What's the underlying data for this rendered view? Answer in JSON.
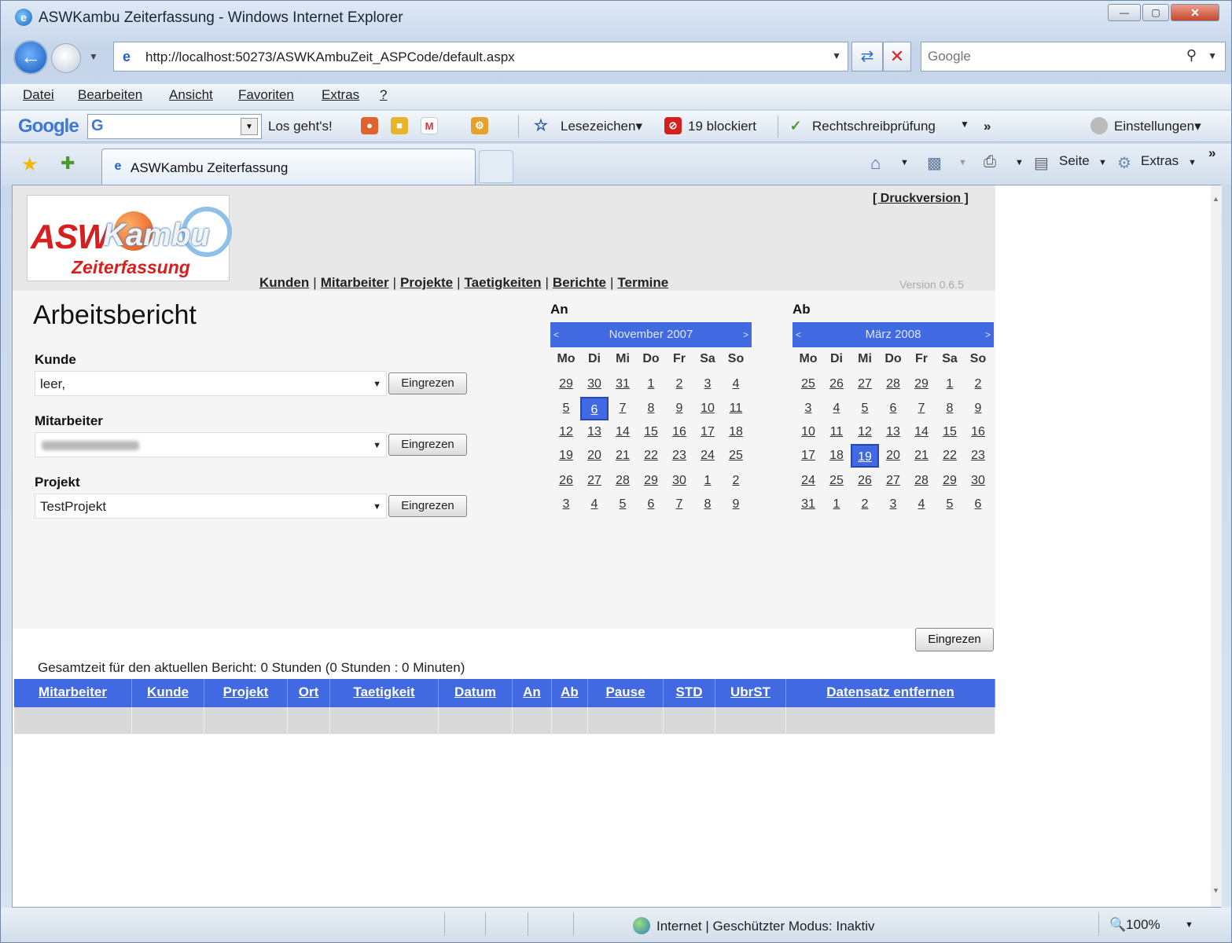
{
  "window": {
    "title": "ASWKambu Zeiterfassung - Windows Internet Explorer"
  },
  "address": {
    "url": "http://localhost:50273/ASWKAmbuZeit_ASPCode/default.aspx"
  },
  "search": {
    "placeholder": "Google"
  },
  "menu": [
    "Datei",
    "Bearbeiten",
    "Ansicht",
    "Favoriten",
    "Extras",
    "?"
  ],
  "google_toolbar": {
    "logo": "Google",
    "go": "Los geht's!",
    "bookmarks": "Lesezeichen▾",
    "blocked": "19 blockiert",
    "spellcheck": "Rechtschreibprüfung",
    "settings": "Einstellungen▾"
  },
  "tab": {
    "label": "ASWKambu Zeiterfassung"
  },
  "command_bar": {
    "page": "Seite",
    "tools": "Extras"
  },
  "header": {
    "logo_main": "ASW",
    "logo_kambu": "Kambu",
    "logo_sub": "Zeiterfassung",
    "print_link": "[ Druckversion ]",
    "version": "Version 0.6.5",
    "nav": [
      "Kunden",
      "Mitarbeiter",
      "Projekte",
      "Taetigkeiten",
      "Berichte",
      "Termine"
    ]
  },
  "report": {
    "title": "Arbeitsbericht",
    "filter_button": "Eingrezen",
    "fields": [
      {
        "label": "Kunde",
        "value": "leer,"
      },
      {
        "label": "Mitarbeiter",
        "value": ""
      },
      {
        "label": "Projekt",
        "value": "TestProjekt"
      }
    ],
    "total": "Gesamtzeit für den aktuellen Bericht: 0 Stunden (0 Stunden : 0 Minuten)"
  },
  "calendars": [
    {
      "label": "An",
      "month": "November 2007",
      "prev": "<",
      "next": ">",
      "dow": [
        "Mo",
        "Di",
        "Mi",
        "Do",
        "Fr",
        "Sa",
        "So"
      ],
      "weeks": [
        [
          "29",
          "30",
          "31",
          "1",
          "2",
          "3",
          "4"
        ],
        [
          "5",
          "6",
          "7",
          "8",
          "9",
          "10",
          "11"
        ],
        [
          "12",
          "13",
          "14",
          "15",
          "16",
          "17",
          "18"
        ],
        [
          "19",
          "20",
          "21",
          "22",
          "23",
          "24",
          "25"
        ],
        [
          "26",
          "27",
          "28",
          "29",
          "30",
          "1",
          "2"
        ],
        [
          "3",
          "4",
          "5",
          "6",
          "7",
          "8",
          "9"
        ]
      ],
      "selected": "6"
    },
    {
      "label": "Ab",
      "month": "März 2008",
      "prev": "<",
      "next": ">",
      "dow": [
        "Mo",
        "Di",
        "Mi",
        "Do",
        "Fr",
        "Sa",
        "So"
      ],
      "weeks": [
        [
          "25",
          "26",
          "27",
          "28",
          "29",
          "1",
          "2"
        ],
        [
          "3",
          "4",
          "5",
          "6",
          "7",
          "8",
          "9"
        ],
        [
          "10",
          "11",
          "12",
          "13",
          "14",
          "15",
          "16"
        ],
        [
          "17",
          "18",
          "19",
          "20",
          "21",
          "22",
          "23"
        ],
        [
          "24",
          "25",
          "26",
          "27",
          "28",
          "29",
          "30"
        ],
        [
          "31",
          "1",
          "2",
          "3",
          "4",
          "5",
          "6"
        ]
      ],
      "selected": "19"
    }
  ],
  "calendar_button": "Eingrezen",
  "table": {
    "headers": [
      "Mitarbeiter",
      "Kunde",
      "Projekt",
      "Ort",
      "Taetigkeit",
      "Datum",
      "An",
      "Ab",
      "Pause",
      "STD",
      "UbrST",
      "Datensatz entfernen"
    ]
  },
  "status": {
    "text": "Internet | Geschützter Modus: Inaktiv",
    "zoom": "100%"
  }
}
